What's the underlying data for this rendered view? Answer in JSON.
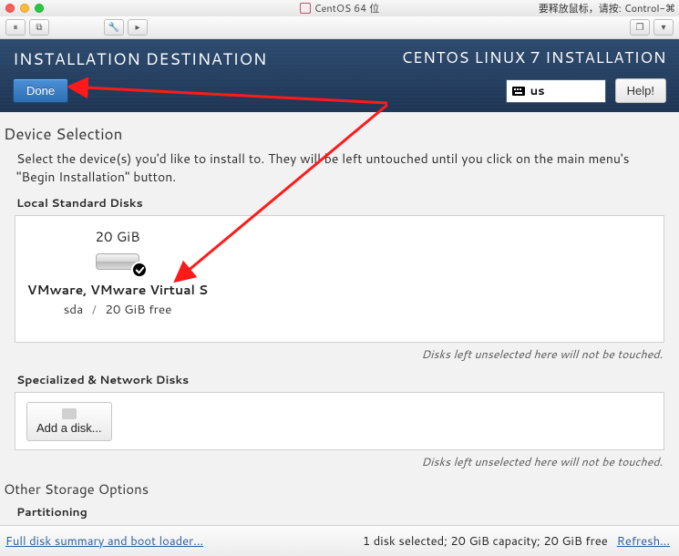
{
  "window": {
    "title": "CentOS 64 位",
    "release_hint": "要释放鼠标，请按: Control-⌘"
  },
  "vm_toolbar": {
    "pause_icon": "⏸",
    "snapshot_icon": "⧉",
    "settings_icon": "🔧",
    "arrow_icon": "▸",
    "fullscreen_icon": "❐",
    "menu_icon": "▾"
  },
  "banner": {
    "title": "INSTALLATION DESTINATION",
    "product": "CENTOS LINUX 7 INSTALLATION",
    "done_label": "Done",
    "keyboard_layout": "us",
    "help_label": "Help!"
  },
  "device_selection": {
    "heading": "Device Selection",
    "paragraph": "Select the device(s) you'd like to install to.  They will be left untouched until you click on the main menu's \"Begin Installation\" button.",
    "local_heading": "Local Standard Disks",
    "disk": {
      "capacity": "20 GiB",
      "name": "VMware, VMware Virtual S",
      "devname": "sda",
      "free": "20 GiB free",
      "selected": true
    },
    "left_note": "Disks left unselected here will not be touched.",
    "network_heading": "Specialized & Network Disks",
    "add_disk_label": "Add a disk...",
    "other_heading": "Other Storage Options",
    "partitioning_label": "Partitioning"
  },
  "footer": {
    "summary_link": "Full disk summary and boot loader...",
    "status": "1 disk selected; 20 GiB capacity; 20 GiB free",
    "refresh_link": "Refresh..."
  }
}
